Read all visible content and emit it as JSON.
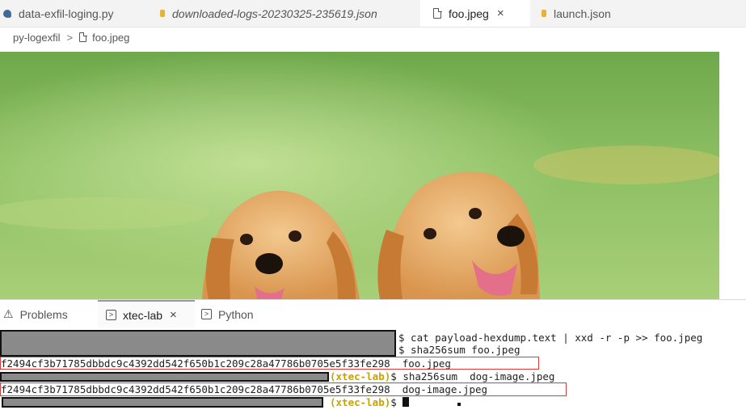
{
  "editor_tabs": [
    {
      "label": "data-exfil-loging.py",
      "icon": "python-file-icon",
      "italic": false,
      "active": false
    },
    {
      "label": "downloaded-logs-20230325-235619.json",
      "icon": "json-file-icon",
      "italic": true,
      "active": false
    },
    {
      "label": "foo.jpeg",
      "icon": "file-icon",
      "italic": false,
      "active": true,
      "close": "×"
    },
    {
      "label": "launch.json",
      "icon": "json-file-icon",
      "italic": false,
      "active": false
    }
  ],
  "breadcrumb": {
    "folder": "py-logexfil",
    "separator": ">",
    "file": "foo.jpeg"
  },
  "preview": {
    "subject": "two golden retriever puppies on grass"
  },
  "panel_tabs": [
    {
      "label": "Problems",
      "icon": "warning-icon",
      "active": false
    },
    {
      "label": "xtec-lab",
      "icon": "terminal-icon",
      "active": true,
      "close": "×"
    },
    {
      "label": "Python",
      "icon": "terminal-icon",
      "active": false
    }
  ],
  "terminal": {
    "line1_cmd": "$ cat payload-hexdump.text | xxd -r -p >> foo.jpeg",
    "line2_cmd": "$ sha256sum foo.jpeg",
    "line3_out": "f2494cf3b71785dbbdc9c4392dd542f650b1c209c28a47786b0705e5f33fe298  foo.jpeg",
    "line4_venv": "(xtec-lab)",
    "line4_cmd": "$ sha256sum  dog-image.jpeg",
    "line5_out": "f2494cf3b71785dbbdc9c4392dd542f650b1c209c28a47786b0705e5f33fe298  dog-image.jpeg",
    "line6_venv": "(xtec-lab)",
    "line6_prompt": "$ "
  },
  "colors": {
    "highlight": "#d93a3a",
    "venv": "#c8a200",
    "redacted": "#8a8a8a"
  }
}
